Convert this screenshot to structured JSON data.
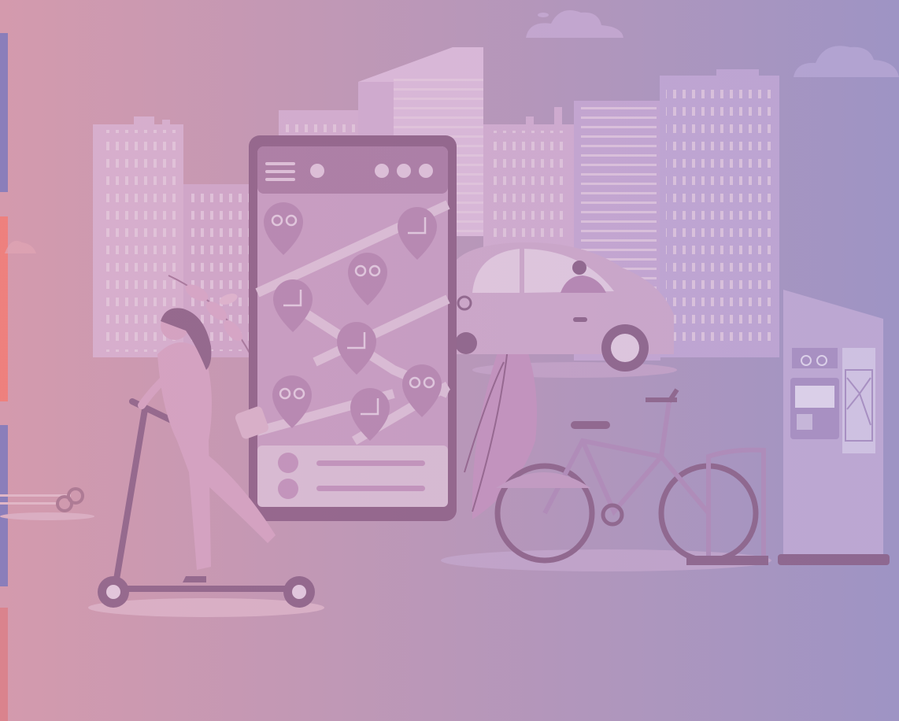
{
  "scene": {
    "description_kind": "illustration",
    "palette": {
      "bg_left": "#d49aad",
      "bg_right": "#9e94c4",
      "building_light": "#d9b3d3",
      "building_mid": "#c9a5c9",
      "building_window": "#e8cfe3",
      "phone_frame": "#8c5e85",
      "phone_screen": "#c99ec4",
      "phone_bar": "#a97aa3",
      "map_road": "#dfc3da",
      "pin": "#b686b1",
      "ground": "#d9b4cf",
      "car_body": "#c9a3c8",
      "kiosk": "#c2abd6",
      "stroke_dark": "#7a5375",
      "accent_blue": "#7b78bd",
      "accent_coral": "#f47b73"
    },
    "left_strips": [
      "blue",
      "coral",
      "blue",
      "coral"
    ],
    "pins": [
      "bike",
      "scooter",
      "bike",
      "scooter",
      "scooter",
      "bike",
      "scooter",
      "bike"
    ]
  }
}
